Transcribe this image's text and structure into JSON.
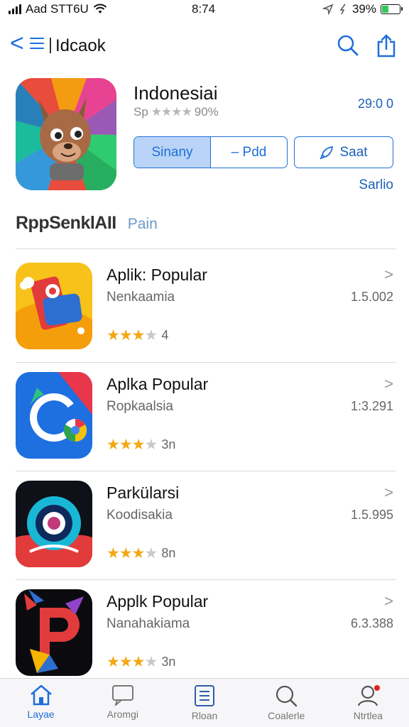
{
  "status_bar": {
    "carrier": "Aad STT6U",
    "time": "8:74",
    "battery": "39%"
  },
  "nav": {
    "title": "Idcaok"
  },
  "hero": {
    "title": "Indonesiai",
    "rating_prefix": "Sp",
    "stars": "★★★★",
    "rating_text": "90%",
    "size": "29:0 0",
    "segment_a": "Sinany",
    "segment_b": "– Pdd",
    "get_label": "Saat",
    "link": "Sarlio"
  },
  "section": {
    "title": "RppSenklAII",
    "link": "Pain"
  },
  "apps": [
    {
      "name": "Aplik: Popular",
      "subtitle": "Nenkaamia",
      "version": "1.5.002",
      "count": "4",
      "stars_on": "★★★",
      "stars_off": "★"
    },
    {
      "name": "Aplka Popular",
      "subtitle": "Ropkaalsia",
      "version": "1:3.291",
      "count": "3n",
      "stars_on": "★★★",
      "stars_off": "★"
    },
    {
      "name": "Parkülarsi",
      "subtitle": "Koodisakia",
      "version": "1.5.995",
      "count": "8n",
      "stars_on": "★★★",
      "stars_off": "★"
    },
    {
      "name": "Applk Popular",
      "subtitle": "Nanahakiama",
      "version": "6.3.388",
      "count": "3n",
      "stars_on": "★★★",
      "stars_off": "★"
    }
  ],
  "tabs": [
    {
      "label": "Layae",
      "icon": "home-icon"
    },
    {
      "label": "Aromgi",
      "icon": "message-icon"
    },
    {
      "label": "Rloan",
      "icon": "list-icon"
    },
    {
      "label": "Coalerle",
      "icon": "search-icon"
    },
    {
      "label": "Ntrtlea",
      "icon": "profile-icon"
    }
  ],
  "colors": {
    "accent": "#1e6fd9",
    "star": "#f3a712",
    "notification": "#e0221f"
  }
}
